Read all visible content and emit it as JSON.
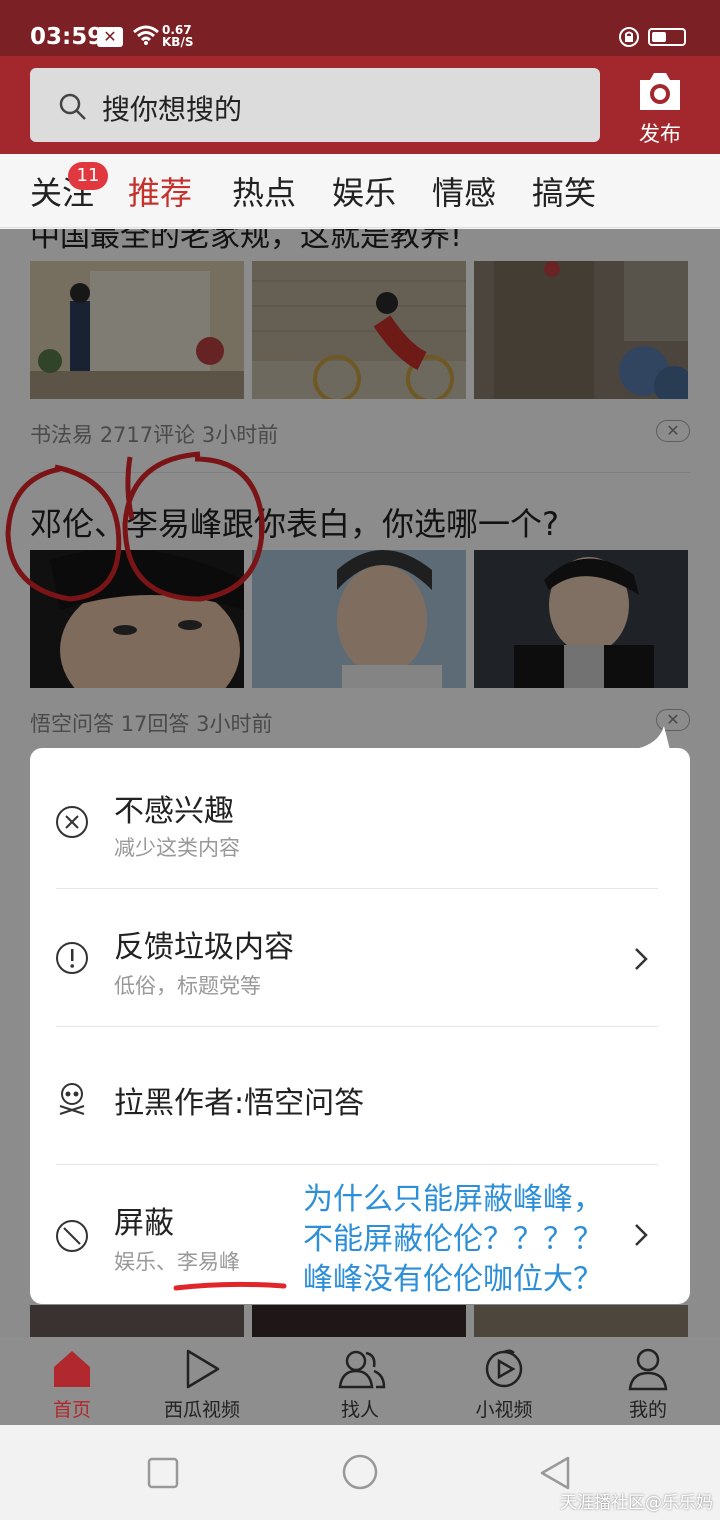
{
  "status": {
    "time": "03:59",
    "net_speed_value": "0.67",
    "net_speed_unit": "KB/S"
  },
  "search": {
    "placeholder": "搜你想搜的",
    "publish_label": "发布"
  },
  "tabs": [
    {
      "label": "关注",
      "badge": "11"
    },
    {
      "label": "推荐"
    },
    {
      "label": "热点"
    },
    {
      "label": "娱乐"
    },
    {
      "label": "情感"
    },
    {
      "label": "搞笑"
    }
  ],
  "feed": {
    "item1": {
      "title_partial": "中国最全的老家规，这就是教养!",
      "source": "书法易",
      "comments": "2717评论",
      "time": "3小时前"
    },
    "item2": {
      "title": "邓伦、李易峰跟你表白，你选哪一个?",
      "source": "悟空问答",
      "answers": "17回答",
      "time": "3小时前"
    }
  },
  "popup": {
    "options": [
      {
        "title": "不感兴趣",
        "subtitle": "减少这类内容",
        "icon": "circle-x-icon"
      },
      {
        "title": "反馈垃圾内容",
        "subtitle": "低俗，标题党等",
        "icon": "exclamation-circle-icon"
      },
      {
        "title": "拉黑作者:悟空问答",
        "icon": "skull-icon"
      },
      {
        "title": "屏蔽",
        "subtitle": "娱乐、李易峰",
        "icon": "block-icon"
      }
    ]
  },
  "annotation": {
    "lines": [
      "为什么只能屏蔽峰峰，",
      "不能屏蔽伦伦？？？？",
      "峰峰没有伦伦咖位大？"
    ],
    "color": "#2c8fd8",
    "mark_color": "#e0262b"
  },
  "bottom_nav": [
    {
      "label": "首页",
      "icon": "home-icon"
    },
    {
      "label": "西瓜视频",
      "icon": "play-icon"
    },
    {
      "label": "找人",
      "icon": "people-icon"
    },
    {
      "label": "小视频",
      "icon": "small-video-icon"
    },
    {
      "label": "我的",
      "icon": "person-icon"
    }
  ],
  "watermark": "天涯播社区@乐乐妈",
  "colors": {
    "brand_red": "#a3282d",
    "status_bar": "#7b2024",
    "active_tab": "#c5322d"
  }
}
